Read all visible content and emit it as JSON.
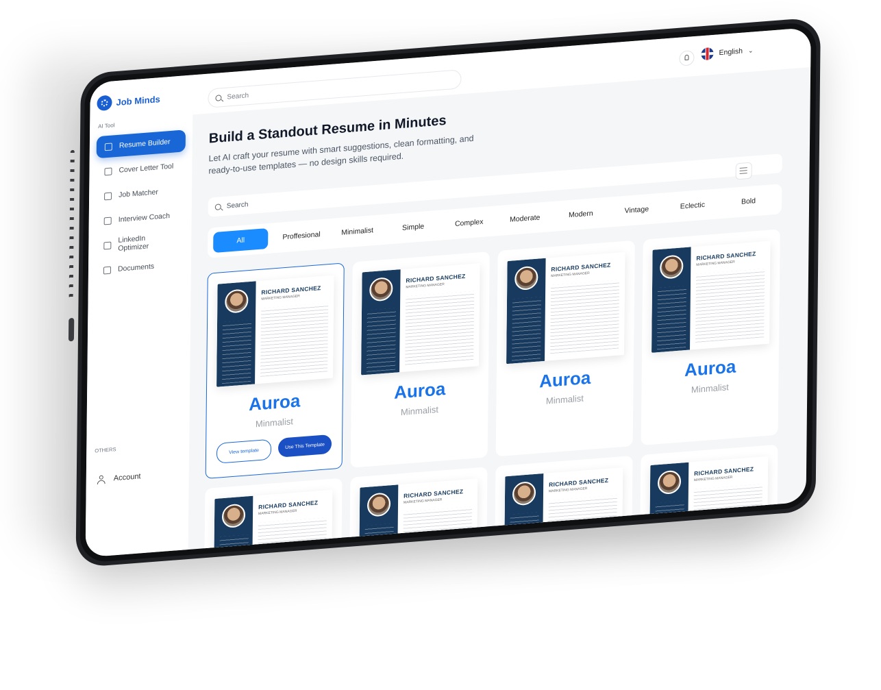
{
  "app": {
    "name": "Job Minds"
  },
  "sidebar": {
    "section_label": "AI Tool",
    "items": [
      {
        "label": "Resume Builder",
        "icon": "resume-icon",
        "active": true
      },
      {
        "label": "Cover Letter Tool",
        "icon": "cover-letter-icon",
        "active": false
      },
      {
        "label": "Job Matcher",
        "icon": "job-matcher-icon",
        "active": false
      },
      {
        "label": "Interview Coach",
        "icon": "interview-icon",
        "active": false
      },
      {
        "label": "LinkedIn Optimizer",
        "icon": "linkedin-icon",
        "active": false
      },
      {
        "label": "Documents",
        "icon": "documents-icon",
        "active": false
      }
    ],
    "others_label": "OTHERS",
    "account_label": "Account"
  },
  "topbar": {
    "search_placeholder": "Search",
    "language": "English"
  },
  "page": {
    "title": "Build a Standout Resume in Minutes",
    "subtitle": "Let AI craft your resume with smart suggestions, clean formatting, and ready-to-use templates — no design skills required.",
    "search_placeholder": "Search",
    "tabs": [
      "All",
      "Proffesional",
      "Minimalist",
      "Simple",
      "Complex",
      "Moderate",
      "Modern",
      "Vintage",
      "Eclectic",
      "Bold"
    ],
    "active_tab": "All"
  },
  "templates": [
    {
      "name": "Auroa",
      "style": "Minmalist",
      "resume_name": "RICHARD SANCHEZ",
      "resume_role": "MARKETING MANAGER",
      "selected": true,
      "view_label": "View template",
      "use_label": "Use This  Template"
    },
    {
      "name": "Auroa",
      "style": "Minmalist",
      "resume_name": "RICHARD SANCHEZ",
      "resume_role": "MARKETING MANAGER"
    },
    {
      "name": "Auroa",
      "style": "Minmalist",
      "resume_name": "RICHARD SANCHEZ",
      "resume_role": "MARKETING MANAGER"
    },
    {
      "name": "Auroa",
      "style": "Minmalist",
      "resume_name": "RICHARD SANCHEZ",
      "resume_role": "MARKETING MANAGER"
    },
    {
      "resume_name": "RICHARD SANCHEZ",
      "resume_role": "MARKETING MANAGER"
    },
    {
      "resume_name": "RICHARD SANCHEZ",
      "resume_role": "MARKETING MANAGER"
    },
    {
      "resume_name": "RICHARD SANCHEZ",
      "resume_role": "MARKETING MANAGER"
    },
    {
      "resume_name": "RICHARD SANCHEZ",
      "resume_role": "MARKETING MANAGER"
    }
  ],
  "colors": {
    "accent": "#1967d6",
    "tab_active": "#1a8cff",
    "resume_sidebar": "#173a5e"
  }
}
